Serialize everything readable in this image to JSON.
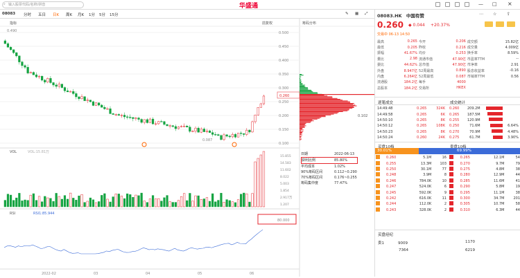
{
  "search": {
    "placeholder": "输入股票代码/名称/拼音"
  },
  "app": {
    "logo": "华盛通"
  },
  "toolbar": {
    "code": "08083",
    "periods": [
      "分时",
      "五日",
      "日K",
      "周K",
      "月K",
      "1分",
      "5分",
      "15分"
    ],
    "active": "日K",
    "adjust": "前复权"
  },
  "main": {
    "label": "指标",
    "price_ticks": [
      "0.500",
      "0.450",
      "0.400",
      "0.350",
      "0.300",
      "0.250",
      "0.200",
      "0.150",
      "0.100"
    ],
    "high_label": "0.490",
    "low_label": "0.087",
    "last_tag": "0.260",
    "distribution_label": "筹码分布",
    "dist_tag": "0.102"
  },
  "vol": {
    "label": "VOL",
    "value": "VOL:15.81万",
    "ticks": [
      "15.855",
      "14.583",
      "11.602",
      "8.022",
      "5.003",
      "1.854",
      "2.917万",
      "1.207"
    ]
  },
  "rsi": {
    "label": "RSI",
    "value": "RSI1:85.944",
    "tick": "80.000"
  },
  "xaxis": [
    "2022-02",
    "03",
    "04",
    "05",
    "06"
  ],
  "chips": {
    "date_label": "日期",
    "date": "2022-06-13",
    "rows": [
      {
        "k": "获利比例",
        "v": "85.80%"
      },
      {
        "k": "平均成本",
        "v": "1.02%"
      },
      {
        "k": "90%筹码区间",
        "v": "0.112~0.290"
      },
      {
        "k": "70%筹码区间",
        "v": "0.176~0.255"
      },
      {
        "k": "筹码集中度",
        "v": "77.47%"
      }
    ]
  },
  "stock": {
    "code": "08083.HK",
    "name": "中国有赞",
    "price": "0.260",
    "change": "0.044",
    "pct": "+20.37%",
    "status": "交易中 06-13 14:50"
  },
  "quote": [
    [
      "最高",
      "0.265",
      "今开",
      "0.206",
      "成交额",
      "15.82亿"
    ],
    [
      "最低",
      "0.205",
      "昨收",
      "0.216",
      "成交量",
      "4.009亿"
    ],
    [
      "振幅",
      "41.67%",
      "均价",
      "0.253",
      "换手率",
      "8.59%"
    ],
    [
      "量比",
      "2.98",
      "流通市值",
      "47.90亿",
      "市盈率TTM",
      "--"
    ],
    [
      "委比",
      "44.62%",
      "总市值",
      "47.90亿",
      "市净率",
      "2.91"
    ],
    [
      "外盘",
      "8.947亿",
      "52周最高",
      "0.890",
      "股息收益率",
      "-0.16"
    ],
    [
      "内盘",
      "6.264亿",
      "52周最低",
      "0.087",
      "市销率TTM",
      "0.56"
    ],
    [
      "流通股",
      "184.2亿",
      "每手",
      "4000",
      "",
      ""
    ],
    [
      "总股本",
      "184.2亿",
      "交易所",
      "HKEX",
      "",
      ""
    ]
  ],
  "tabs": {
    "t1": "逐笔成交",
    "t2": "成交统计"
  },
  "ticks": [
    [
      "14:49:48",
      "0.265",
      "324K"
    ],
    [
      "14:49:58",
      "0.265",
      "6K"
    ],
    [
      "14:50:10",
      "0.265",
      "8K"
    ],
    [
      "14:50:12",
      "0.265",
      "108K"
    ],
    [
      "14:50:23",
      "0.265",
      "8K"
    ],
    [
      "14:50:24",
      "0.260",
      "24K"
    ]
  ],
  "stats": [
    [
      "0.260",
      "209.2M"
    ],
    [
      "0.265",
      "187.5M"
    ],
    [
      "0.255",
      "120.9M"
    ],
    [
      "0.250",
      "71.6M"
    ],
    [
      "0.270",
      "70.9M"
    ],
    [
      "0.275",
      "61.7M"
    ]
  ],
  "stats_pct": [
    "",
    "",
    "",
    "6.64%",
    "4.48%",
    "3.90%"
  ],
  "book": {
    "bid_label": "买盘10档",
    "ask_label": "卖盘10档",
    "bid_pct": "30.01%",
    "ask_pct": "69.99%",
    "bids": [
      [
        "0.260",
        "5.1M",
        "16"
      ],
      [
        "0.255",
        "13.3M",
        "103"
      ],
      [
        "0.250",
        "30.1M",
        "77"
      ],
      [
        "0.248",
        "3.9M",
        "8"
      ],
      [
        "0.246",
        "784.0K",
        "10"
      ],
      [
        "0.247",
        "524.0K",
        "6"
      ],
      [
        "0.245",
        "592.0K",
        "9"
      ],
      [
        "0.242",
        "616.0K",
        "11"
      ],
      [
        "0.244",
        "112.0K",
        "2"
      ],
      [
        "0.243",
        "328.0K",
        "2"
      ]
    ],
    "asks": [
      [
        "0.265",
        "12.1M",
        "54"
      ],
      [
        "0.270",
        "9.7M",
        "79"
      ],
      [
        "0.275",
        "4.8M",
        "38"
      ],
      [
        "0.280",
        "12.9M",
        "44"
      ],
      [
        "0.285",
        "11.6M",
        "41"
      ],
      [
        "0.290",
        "5.8M",
        "19"
      ],
      [
        "0.295",
        "11.1M",
        "38"
      ],
      [
        "0.300",
        "34.7M",
        "201"
      ],
      [
        "0.305",
        "10.7M",
        "58"
      ],
      [
        "0.310",
        "6.3M",
        "44"
      ]
    ]
  },
  "brokers": {
    "label": "买盘经纪",
    "rows": [
      [
        "卖1",
        "9009",
        "1170"
      ],
      [
        "",
        "7364",
        "6219"
      ]
    ]
  }
}
